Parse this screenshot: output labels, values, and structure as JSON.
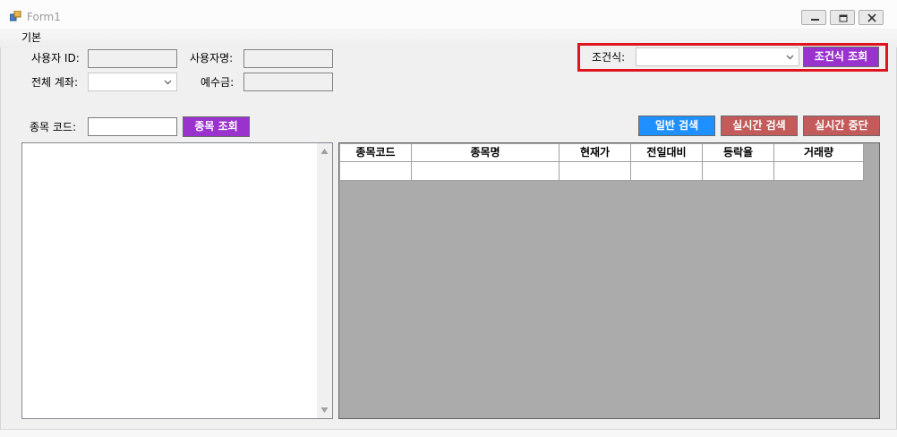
{
  "window": {
    "title": "Form1"
  },
  "menu": {
    "items": [
      "기본"
    ]
  },
  "form": {
    "user_id_label": "사용자 ID:",
    "user_name_label": "사용자명:",
    "account_label": "전체 계좌:",
    "deposit_label": "예수금:",
    "stock_code_label": "종목 코드:",
    "stock_search_button": "종목 조회",
    "condition_label": "조건식:",
    "condition_search_button": "조건식 조회",
    "normal_search_button": "일반 검색",
    "realtime_search_button": "실시간 검색",
    "realtime_stop_button": "실시간 중단"
  },
  "grid": {
    "columns": [
      "종목코드",
      "종목명",
      "현재가",
      "전일대비",
      "등락율",
      "거래량"
    ]
  },
  "colors": {
    "purple_button": "#9a32cd",
    "blue_button": "#1e90ff",
    "red_button": "#c35b5b",
    "highlight_border": "#e0141f",
    "grid_background": "#ababab"
  }
}
